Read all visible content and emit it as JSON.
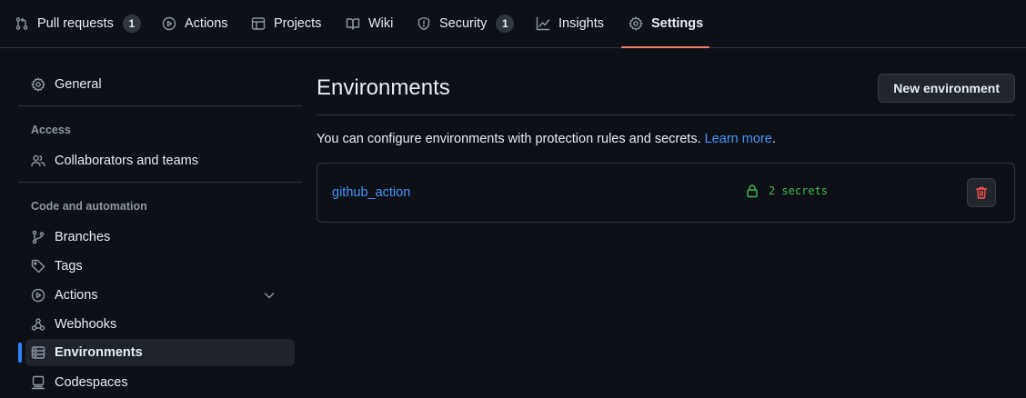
{
  "topnav": {
    "tabs": [
      {
        "label": "Pull requests",
        "counter": "1",
        "icon": "git-pull-request-icon"
      },
      {
        "label": "Actions",
        "icon": "play-icon"
      },
      {
        "label": "Projects",
        "icon": "table-icon"
      },
      {
        "label": "Wiki",
        "icon": "book-icon"
      },
      {
        "label": "Security",
        "counter": "1",
        "icon": "shield-icon"
      },
      {
        "label": "Insights",
        "icon": "graph-icon"
      },
      {
        "label": "Settings",
        "icon": "gear-icon",
        "selected": true
      }
    ]
  },
  "sidebar": {
    "general": "General",
    "access_heading": "Access",
    "collaborators": "Collaborators and teams",
    "code_heading": "Code and automation",
    "branches": "Branches",
    "tags": "Tags",
    "actions": "Actions",
    "webhooks": "Webhooks",
    "environments": "Environments",
    "codespaces": "Codespaces"
  },
  "main": {
    "title": "Environments",
    "new_button": "New environment",
    "description": "You can configure environments with protection rules and secrets.",
    "learn_more": "Learn more",
    "description_end": ".",
    "environments": [
      {
        "name": "github_action",
        "secrets": "2 secrets"
      }
    ]
  },
  "colors": {
    "background": "#0d1117",
    "accent_underline": "#f78166",
    "link": "#4493f8",
    "success": "#3fb950",
    "danger": "#f85149",
    "active_indicator": "#2f81f7"
  }
}
